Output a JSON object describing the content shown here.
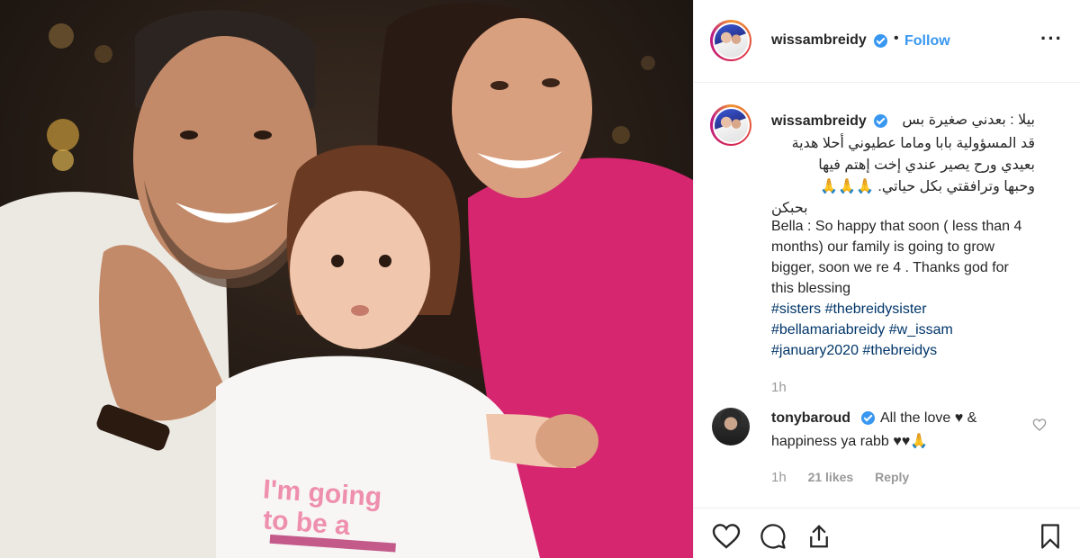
{
  "post": {
    "username": "wissambreidy",
    "separator": "•",
    "follow_label": "Follow",
    "more_icon": "···",
    "photo_shirt_text_line1": "I'm going",
    "photo_shirt_text_line2": "to be a"
  },
  "caption": {
    "username": "wissambreidy",
    "arabic_lines": [
      "بيلا : بعدني صغيرة بس",
      "قد المسؤولية بابا وماما عطيوني أحلا هدية",
      "بعيدي ورح يصير عندي إخت إهتم فيها",
      "وحبها وترافقتي بكل حياتي. 🙏🙏🙏",
      "بحبكن"
    ],
    "english_lines": [
      "Bella : So happy that soon ( less than 4",
      "months) our family is going to grow",
      "bigger, soon we re 4 . Thanks god for",
      "this blessing"
    ],
    "hashtag_lines": [
      "#sisters #thebreidysister",
      "#bellamariabreidy #w_issam",
      "#january2020 #thebreidys"
    ],
    "time": "1h"
  },
  "comment": {
    "username": "tonybaroud",
    "text_line1": "All the love ♥ &",
    "text_line2": "happiness ya rabb ♥♥🙏",
    "time": "1h",
    "likes": "21 likes",
    "reply_label": "Reply"
  },
  "colors": {
    "link_blue": "#3897f0",
    "hashtag": "#003569",
    "muted": "#999999"
  },
  "icons": {
    "like": "heart-outline",
    "comment": "speech-bubble",
    "share": "share-up-arrow",
    "save": "bookmark-outline"
  }
}
